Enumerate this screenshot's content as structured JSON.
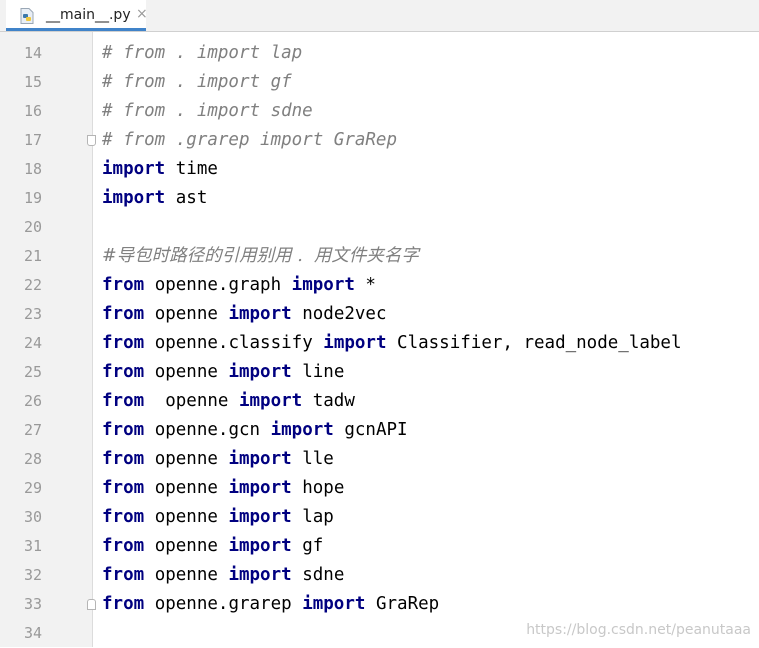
{
  "tab": {
    "filename": "__main__.py",
    "close": "×",
    "icon": "python-file-icon"
  },
  "editor": {
    "lines": [
      {
        "num": "14",
        "parts": [
          {
            "t": "# from . import lap",
            "c": "cm"
          }
        ]
      },
      {
        "num": "15",
        "parts": [
          {
            "t": "# from . import gf",
            "c": "cm"
          }
        ]
      },
      {
        "num": "16",
        "parts": [
          {
            "t": "# from . import sdne",
            "c": "cm"
          }
        ]
      },
      {
        "num": "17",
        "parts": [
          {
            "t": "# from .grarep import GraRep",
            "c": "cm"
          }
        ],
        "fold": "start"
      },
      {
        "num": "18",
        "parts": [
          {
            "t": "import",
            "c": "kw"
          },
          {
            "t": " time",
            "c": ""
          }
        ]
      },
      {
        "num": "19",
        "parts": [
          {
            "t": "import",
            "c": "kw"
          },
          {
            "t": " ast",
            "c": ""
          }
        ]
      },
      {
        "num": "20",
        "parts": []
      },
      {
        "num": "21",
        "parts": [
          {
            "t": "#导包时路径的引用别用 .  用文件夹名字",
            "c": "cm cm-cn"
          }
        ]
      },
      {
        "num": "22",
        "parts": [
          {
            "t": "from",
            "c": "kw"
          },
          {
            "t": " openne.graph ",
            "c": ""
          },
          {
            "t": "import",
            "c": "kw"
          },
          {
            "t": " *",
            "c": ""
          }
        ]
      },
      {
        "num": "23",
        "parts": [
          {
            "t": "from",
            "c": "kw"
          },
          {
            "t": " openne ",
            "c": ""
          },
          {
            "t": "import",
            "c": "kw"
          },
          {
            "t": " node2vec",
            "c": ""
          }
        ]
      },
      {
        "num": "24",
        "parts": [
          {
            "t": "from",
            "c": "kw"
          },
          {
            "t": " openne.classify ",
            "c": ""
          },
          {
            "t": "import",
            "c": "kw"
          },
          {
            "t": " Classifier, read_node_label",
            "c": ""
          }
        ]
      },
      {
        "num": "25",
        "parts": [
          {
            "t": "from",
            "c": "kw"
          },
          {
            "t": " openne ",
            "c": ""
          },
          {
            "t": "import",
            "c": "kw"
          },
          {
            "t": " line",
            "c": ""
          }
        ]
      },
      {
        "num": "26",
        "parts": [
          {
            "t": "from",
            "c": "kw"
          },
          {
            "t": "  openne ",
            "c": ""
          },
          {
            "t": "import",
            "c": "kw"
          },
          {
            "t": " tadw",
            "c": ""
          }
        ]
      },
      {
        "num": "27",
        "parts": [
          {
            "t": "from",
            "c": "kw"
          },
          {
            "t": " openne.gcn ",
            "c": ""
          },
          {
            "t": "import",
            "c": "kw"
          },
          {
            "t": " gcnAPI",
            "c": ""
          }
        ]
      },
      {
        "num": "28",
        "parts": [
          {
            "t": "from",
            "c": "kw"
          },
          {
            "t": " openne ",
            "c": ""
          },
          {
            "t": "import",
            "c": "kw"
          },
          {
            "t": " lle",
            "c": ""
          }
        ]
      },
      {
        "num": "29",
        "parts": [
          {
            "t": "from",
            "c": "kw"
          },
          {
            "t": " openne ",
            "c": ""
          },
          {
            "t": "import",
            "c": "kw"
          },
          {
            "t": " hope",
            "c": ""
          }
        ]
      },
      {
        "num": "30",
        "parts": [
          {
            "t": "from",
            "c": "kw"
          },
          {
            "t": " openne ",
            "c": ""
          },
          {
            "t": "import",
            "c": "kw"
          },
          {
            "t": " lap",
            "c": ""
          }
        ]
      },
      {
        "num": "31",
        "parts": [
          {
            "t": "from",
            "c": "kw"
          },
          {
            "t": " openne ",
            "c": ""
          },
          {
            "t": "import",
            "c": "kw"
          },
          {
            "t": " gf",
            "c": ""
          }
        ]
      },
      {
        "num": "32",
        "parts": [
          {
            "t": "from",
            "c": "kw"
          },
          {
            "t": " openne ",
            "c": ""
          },
          {
            "t": "import",
            "c": "kw"
          },
          {
            "t": " sdne",
            "c": ""
          }
        ]
      },
      {
        "num": "33",
        "parts": [
          {
            "t": "from",
            "c": "kw"
          },
          {
            "t": " openne.grarep ",
            "c": ""
          },
          {
            "t": "import",
            "c": "kw"
          },
          {
            "t": " GraRep",
            "c": ""
          }
        ],
        "fold": "end"
      },
      {
        "num": "34",
        "parts": []
      }
    ]
  },
  "watermark": "https://blog.csdn.net/peanutaaa",
  "colors": {
    "keyword": "#000080",
    "comment": "#808080",
    "gutter_bg": "#f2f2f2",
    "line_number": "#999999",
    "tab_accent": "#4083c9"
  }
}
